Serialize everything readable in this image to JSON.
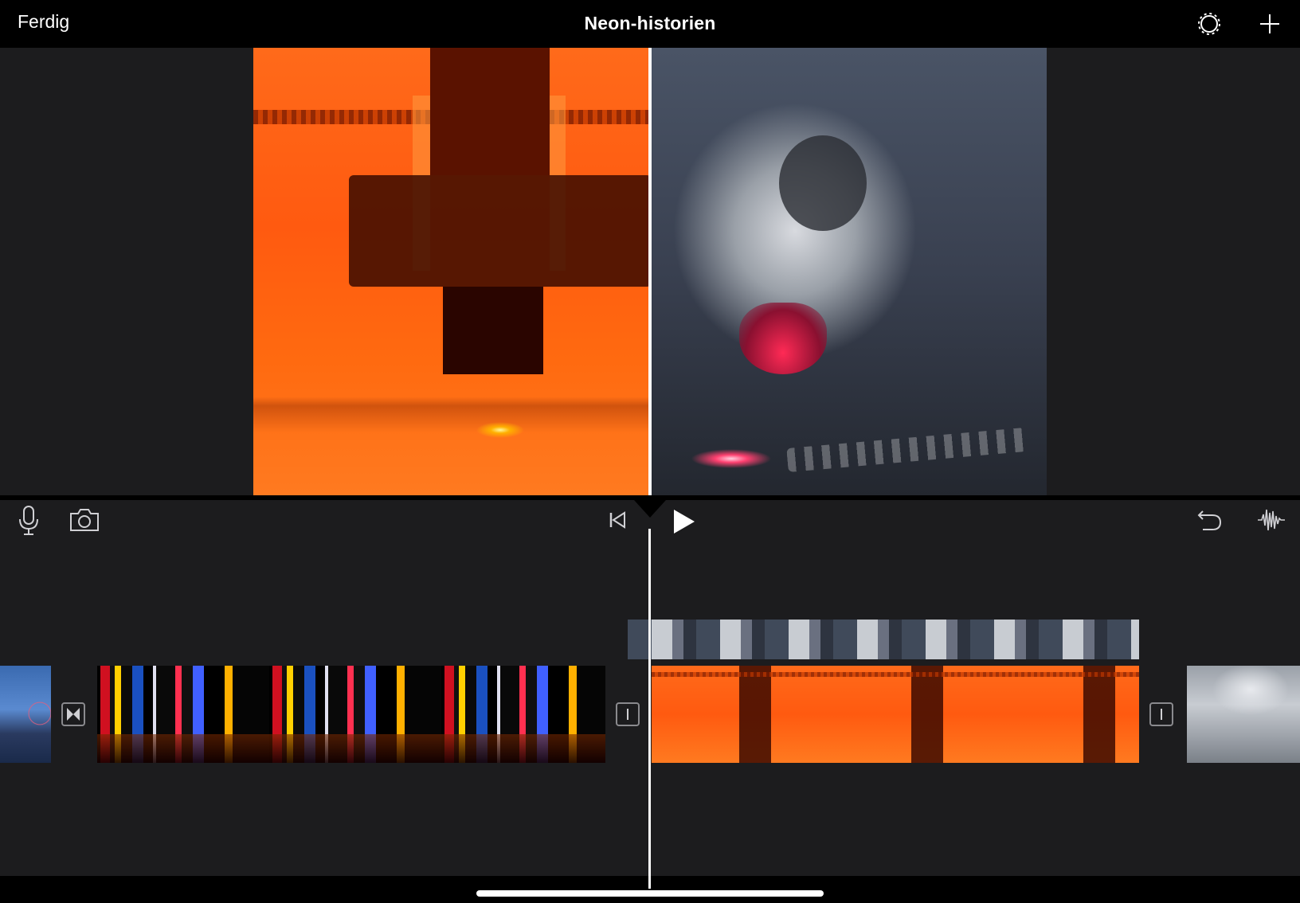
{
  "topbar": {
    "done_label": "Ferdig",
    "title": "Neon-historien",
    "settings_icon": "gear-icon",
    "add_icon": "plus-icon"
  },
  "viewer": {
    "layout": "split-screen",
    "left_clip": "orange laser cutter",
    "right_clip": "metal laser head with red dot"
  },
  "toolbar": {
    "mic_icon": "microphone-icon",
    "camera_icon": "camera-icon",
    "skip_start_icon": "skip-to-start-icon",
    "play_icon": "play-icon",
    "undo_icon": "undo-icon",
    "audio_icon": "audio-waveform-icon"
  },
  "timeline": {
    "clips": [
      {
        "name": "clip-ferris-wheel"
      },
      {
        "name": "clip-neon-city"
      },
      {
        "name": "clip-laser-overlay"
      },
      {
        "name": "clip-laser-orange"
      },
      {
        "name": "clip-steaming-pot"
      }
    ],
    "transitions": [
      {
        "type": "cross-dissolve"
      },
      {
        "type": "none"
      },
      {
        "type": "none"
      }
    ]
  },
  "colors": {
    "background": "#1c1c1e",
    "bar": "#000000",
    "accent": "#ffffff"
  }
}
